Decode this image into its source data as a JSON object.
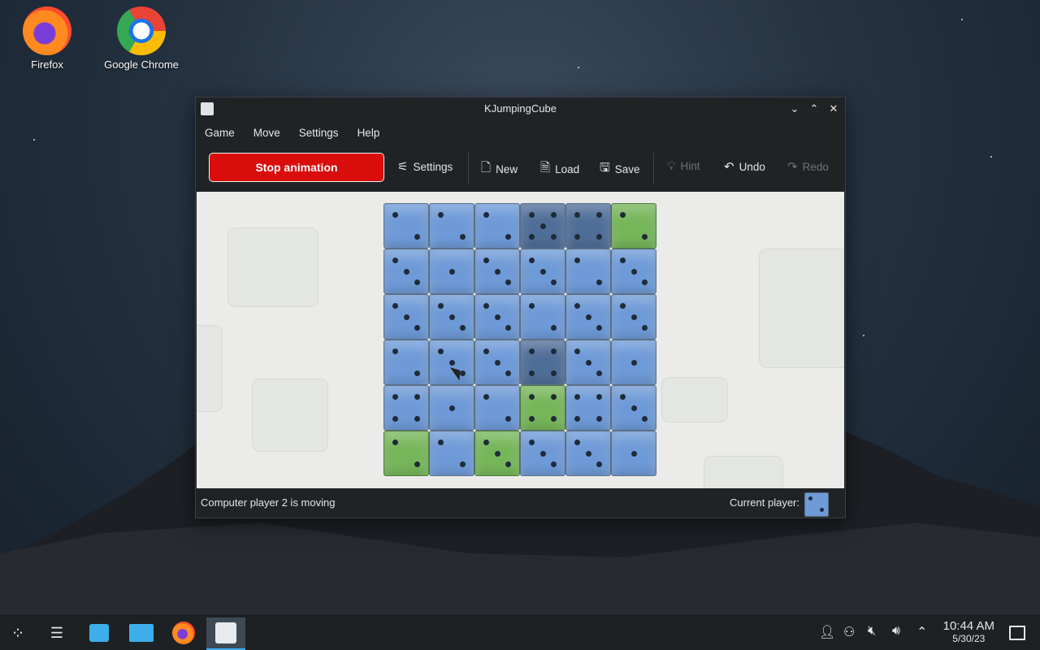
{
  "desktop": {
    "icons": [
      {
        "label": "Firefox"
      },
      {
        "label": "Google Chrome"
      }
    ]
  },
  "window": {
    "title": "KJumpingCube",
    "menu": [
      "Game",
      "Move",
      "Settings",
      "Help"
    ],
    "toolbar": {
      "stop_animation": "Stop animation",
      "settings": "Settings",
      "new": "New",
      "load": "Load",
      "save": "Save",
      "hint": "Hint",
      "undo": "Undo",
      "redo": "Redo"
    },
    "status": {
      "message": "Computer player 2 is moving",
      "current_player_label": "Current player:"
    },
    "board": {
      "rows": [
        [
          {
            "c": "blue",
            "n": 2
          },
          {
            "c": "blue",
            "n": 2
          },
          {
            "c": "blue",
            "n": 2
          },
          {
            "c": "dark",
            "n": 5
          },
          {
            "c": "dark",
            "n": 4
          },
          {
            "c": "green",
            "n": 2
          }
        ],
        [
          {
            "c": "blue",
            "n": 3
          },
          {
            "c": "blue",
            "n": 1
          },
          {
            "c": "blue",
            "n": 3
          },
          {
            "c": "blue",
            "n": 3
          },
          {
            "c": "blue",
            "n": 2
          },
          {
            "c": "blue",
            "n": 3
          }
        ],
        [
          {
            "c": "blue",
            "n": 3
          },
          {
            "c": "blue",
            "n": 3
          },
          {
            "c": "blue",
            "n": 3
          },
          {
            "c": "blue",
            "n": 2
          },
          {
            "c": "blue",
            "n": 3
          },
          {
            "c": "blue",
            "n": 3
          }
        ],
        [
          {
            "c": "blue",
            "n": 2
          },
          {
            "c": "blue",
            "n": 3
          },
          {
            "c": "blue",
            "n": 3
          },
          {
            "c": "dark",
            "n": 4
          },
          {
            "c": "blue",
            "n": 3
          },
          {
            "c": "blue",
            "n": 1
          }
        ],
        [
          {
            "c": "blue",
            "n": 4
          },
          {
            "c": "blue",
            "n": 1
          },
          {
            "c": "blue",
            "n": 2
          },
          {
            "c": "green",
            "n": 4
          },
          {
            "c": "blue",
            "n": 4
          },
          {
            "c": "blue",
            "n": 3
          }
        ],
        [
          {
            "c": "green",
            "n": 2
          },
          {
            "c": "blue",
            "n": 2
          },
          {
            "c": "green",
            "n": 3
          },
          {
            "c": "blue",
            "n": 3
          },
          {
            "c": "blue",
            "n": 3
          },
          {
            "c": "blue",
            "n": 1
          }
        ]
      ]
    }
  },
  "taskbar": {
    "time": "10:44 AM",
    "date": "5/30/23"
  }
}
